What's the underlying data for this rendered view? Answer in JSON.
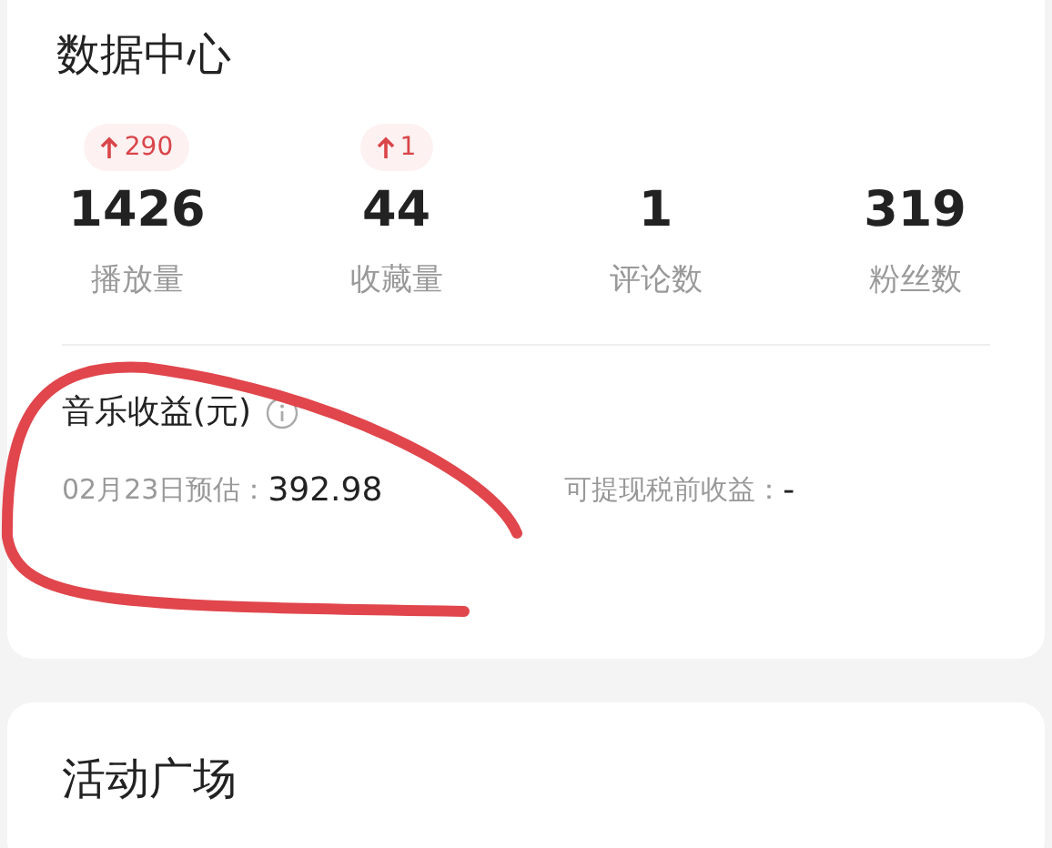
{
  "data_center": {
    "title": "数据中心",
    "stats": [
      {
        "change": "290",
        "value": "1426",
        "label": "播放量"
      },
      {
        "change": "1",
        "value": "44",
        "label": "收藏量"
      },
      {
        "value": "1",
        "label": "评论数"
      },
      {
        "value": "319",
        "label": "粉丝数"
      }
    ]
  },
  "music_income": {
    "title": "音乐收益(元)",
    "estimate_label": "02月23日预估：",
    "estimate_value": "392.98",
    "withdrawable_label": "可提现税前收益：",
    "withdrawable_value": "-"
  },
  "activity": {
    "title": "活动广场"
  }
}
